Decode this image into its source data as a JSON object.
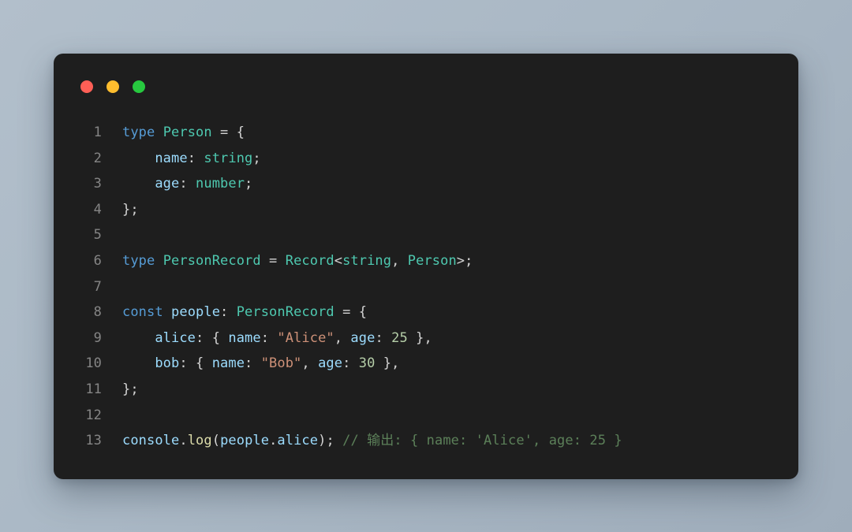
{
  "window": {
    "dots": [
      {
        "name": "close-dot",
        "color": "#ff5f56"
      },
      {
        "name": "minimize-dot",
        "color": "#ffbd2e"
      },
      {
        "name": "maximize-dot",
        "color": "#27c93f"
      }
    ]
  },
  "editor": {
    "language": "typescript",
    "theme": "dark-plus",
    "background": "#1e1e1e",
    "gutter_color": "#858585",
    "colors": {
      "keyword": "#569cd6",
      "type": "#4ec9b0",
      "property": "#9cdcfe",
      "string": "#ce9178",
      "number": "#b5cea8",
      "function": "#dcdcaa",
      "comment": "#5c8059",
      "punctuation": "#d4d4d4"
    },
    "lines": [
      {
        "number": "1",
        "plain": "type Person = {",
        "tokens": [
          {
            "t": "type",
            "c": "t-key"
          },
          {
            "t": " ",
            "c": "t-punc"
          },
          {
            "t": "Person",
            "c": "t-type"
          },
          {
            "t": " = {",
            "c": "t-punc"
          }
        ]
      },
      {
        "number": "2",
        "plain": "    name: string;",
        "tokens": [
          {
            "t": "    ",
            "c": "t-punc"
          },
          {
            "t": "name",
            "c": "t-prop"
          },
          {
            "t": ": ",
            "c": "t-punc"
          },
          {
            "t": "string",
            "c": "t-type"
          },
          {
            "t": ";",
            "c": "t-punc"
          }
        ]
      },
      {
        "number": "3",
        "plain": "    age: number;",
        "tokens": [
          {
            "t": "    ",
            "c": "t-punc"
          },
          {
            "t": "age",
            "c": "t-prop"
          },
          {
            "t": ": ",
            "c": "t-punc"
          },
          {
            "t": "number",
            "c": "t-type"
          },
          {
            "t": ";",
            "c": "t-punc"
          }
        ]
      },
      {
        "number": "4",
        "plain": "};",
        "tokens": [
          {
            "t": "};",
            "c": "t-punc"
          }
        ]
      },
      {
        "number": "5",
        "plain": "",
        "tokens": []
      },
      {
        "number": "6",
        "plain": "type PersonRecord = Record<string, Person>;",
        "tokens": [
          {
            "t": "type",
            "c": "t-key"
          },
          {
            "t": " ",
            "c": "t-punc"
          },
          {
            "t": "PersonRecord",
            "c": "t-type"
          },
          {
            "t": " = ",
            "c": "t-punc"
          },
          {
            "t": "Record",
            "c": "t-type"
          },
          {
            "t": "<",
            "c": "t-punc"
          },
          {
            "t": "string",
            "c": "t-type"
          },
          {
            "t": ", ",
            "c": "t-punc"
          },
          {
            "t": "Person",
            "c": "t-type"
          },
          {
            "t": ">;",
            "c": "t-punc"
          }
        ]
      },
      {
        "number": "7",
        "plain": "",
        "tokens": []
      },
      {
        "number": "8",
        "plain": "const people: PersonRecord = {",
        "tokens": [
          {
            "t": "const",
            "c": "t-key"
          },
          {
            "t": " ",
            "c": "t-punc"
          },
          {
            "t": "people",
            "c": "t-prop"
          },
          {
            "t": ": ",
            "c": "t-punc"
          },
          {
            "t": "PersonRecord",
            "c": "t-type"
          },
          {
            "t": " = {",
            "c": "t-punc"
          }
        ]
      },
      {
        "number": "9",
        "plain": "    alice: { name: \"Alice\", age: 25 },",
        "tokens": [
          {
            "t": "    ",
            "c": "t-punc"
          },
          {
            "t": "alice",
            "c": "t-prop"
          },
          {
            "t": ": { ",
            "c": "t-punc"
          },
          {
            "t": "name",
            "c": "t-prop"
          },
          {
            "t": ": ",
            "c": "t-punc"
          },
          {
            "t": "\"Alice\"",
            "c": "t-str"
          },
          {
            "t": ", ",
            "c": "t-punc"
          },
          {
            "t": "age",
            "c": "t-prop"
          },
          {
            "t": ": ",
            "c": "t-punc"
          },
          {
            "t": "25",
            "c": "t-num"
          },
          {
            "t": " },",
            "c": "t-punc"
          }
        ]
      },
      {
        "number": "10",
        "plain": "    bob: { name: \"Bob\", age: 30 },",
        "tokens": [
          {
            "t": "    ",
            "c": "t-punc"
          },
          {
            "t": "bob",
            "c": "t-prop"
          },
          {
            "t": ": { ",
            "c": "t-punc"
          },
          {
            "t": "name",
            "c": "t-prop"
          },
          {
            "t": ": ",
            "c": "t-punc"
          },
          {
            "t": "\"Bob\"",
            "c": "t-str"
          },
          {
            "t": ", ",
            "c": "t-punc"
          },
          {
            "t": "age",
            "c": "t-prop"
          },
          {
            "t": ": ",
            "c": "t-punc"
          },
          {
            "t": "30",
            "c": "t-num"
          },
          {
            "t": " },",
            "c": "t-punc"
          }
        ]
      },
      {
        "number": "11",
        "plain": "};",
        "tokens": [
          {
            "t": "};",
            "c": "t-punc"
          }
        ]
      },
      {
        "number": "12",
        "plain": "",
        "tokens": []
      },
      {
        "number": "13",
        "plain": "console.log(people.alice); // 输出: { name: 'Alice', age: 25 }",
        "tokens": [
          {
            "t": "console",
            "c": "t-prop"
          },
          {
            "t": ".",
            "c": "t-punc"
          },
          {
            "t": "log",
            "c": "t-fn"
          },
          {
            "t": "(",
            "c": "t-punc"
          },
          {
            "t": "people",
            "c": "t-prop"
          },
          {
            "t": ".",
            "c": "t-punc"
          },
          {
            "t": "alice",
            "c": "t-prop"
          },
          {
            "t": ");",
            "c": "t-punc"
          },
          {
            "t": " ",
            "c": "t-punc"
          },
          {
            "t": "// 输出: { name: 'Alice', age: 25 }",
            "c": "t-com"
          }
        ]
      }
    ]
  }
}
